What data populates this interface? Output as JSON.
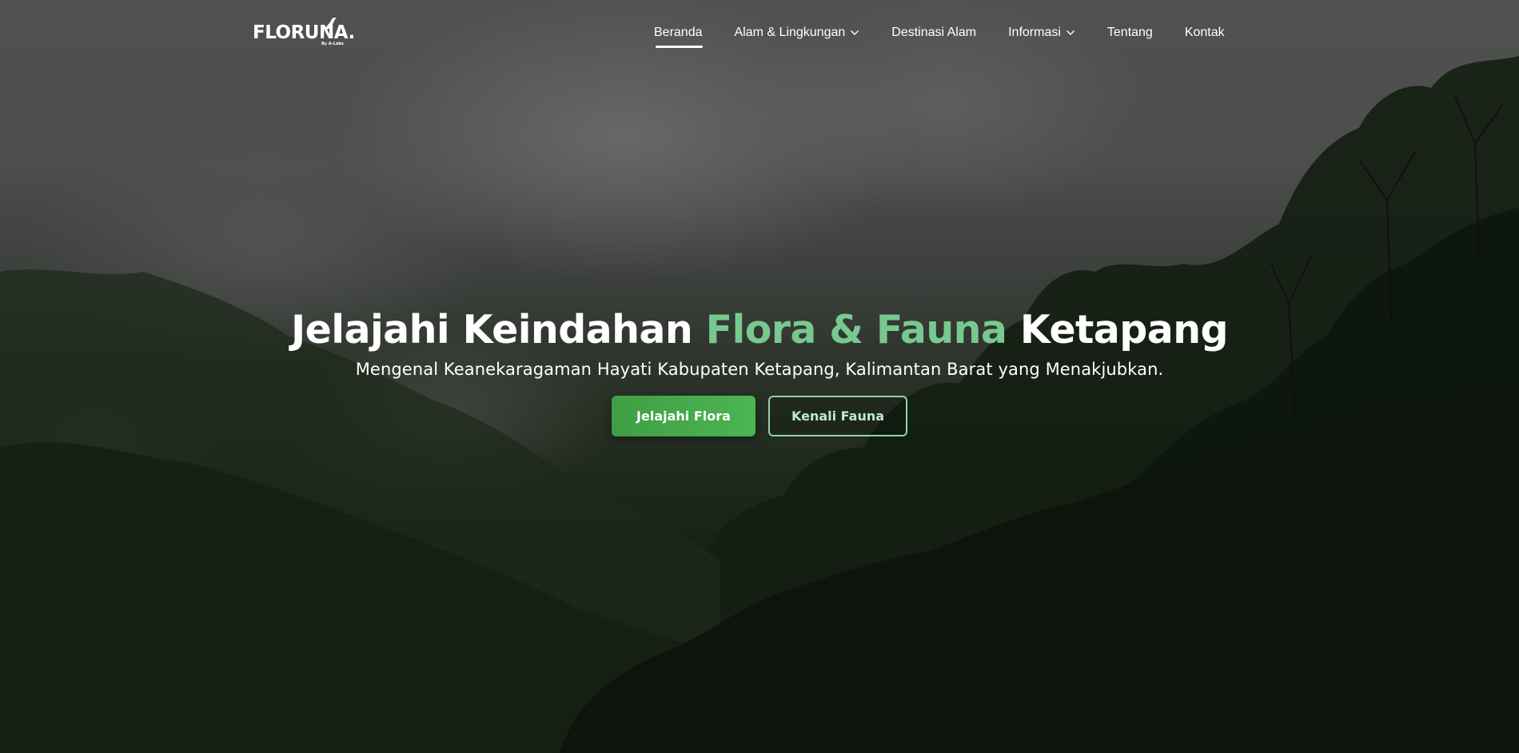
{
  "brand": {
    "name": "FLORUNA.",
    "tagline": "By A-Labs"
  },
  "nav": {
    "items": [
      {
        "label": "Beranda",
        "active": true,
        "dropdown": false
      },
      {
        "label": "Alam & Lingkungan",
        "active": false,
        "dropdown": true
      },
      {
        "label": "Destinasi Alam",
        "active": false,
        "dropdown": false
      },
      {
        "label": "Informasi",
        "active": false,
        "dropdown": true
      },
      {
        "label": "Tentang",
        "active": false,
        "dropdown": false
      },
      {
        "label": "Kontak",
        "active": false,
        "dropdown": false
      }
    ]
  },
  "hero": {
    "title_part1": "Jelajahi Keindahan ",
    "title_accent": "Flora & Fauna",
    "title_part2": " Ketapang",
    "subtitle": "Mengenal Keanekaragaman Hayati Kabupaten Ketapang, Kalimantan Barat yang Menakjubkan.",
    "primary_button": "Jelajahi Flora",
    "secondary_button": "Kenali Fauna"
  },
  "colors": {
    "accent": "#77c98f",
    "primary_button": "#4cb552",
    "outline_button": "#8fd6a4"
  },
  "icons": {
    "dropdown": "chevron-down-icon",
    "logo": "bird-icon"
  }
}
